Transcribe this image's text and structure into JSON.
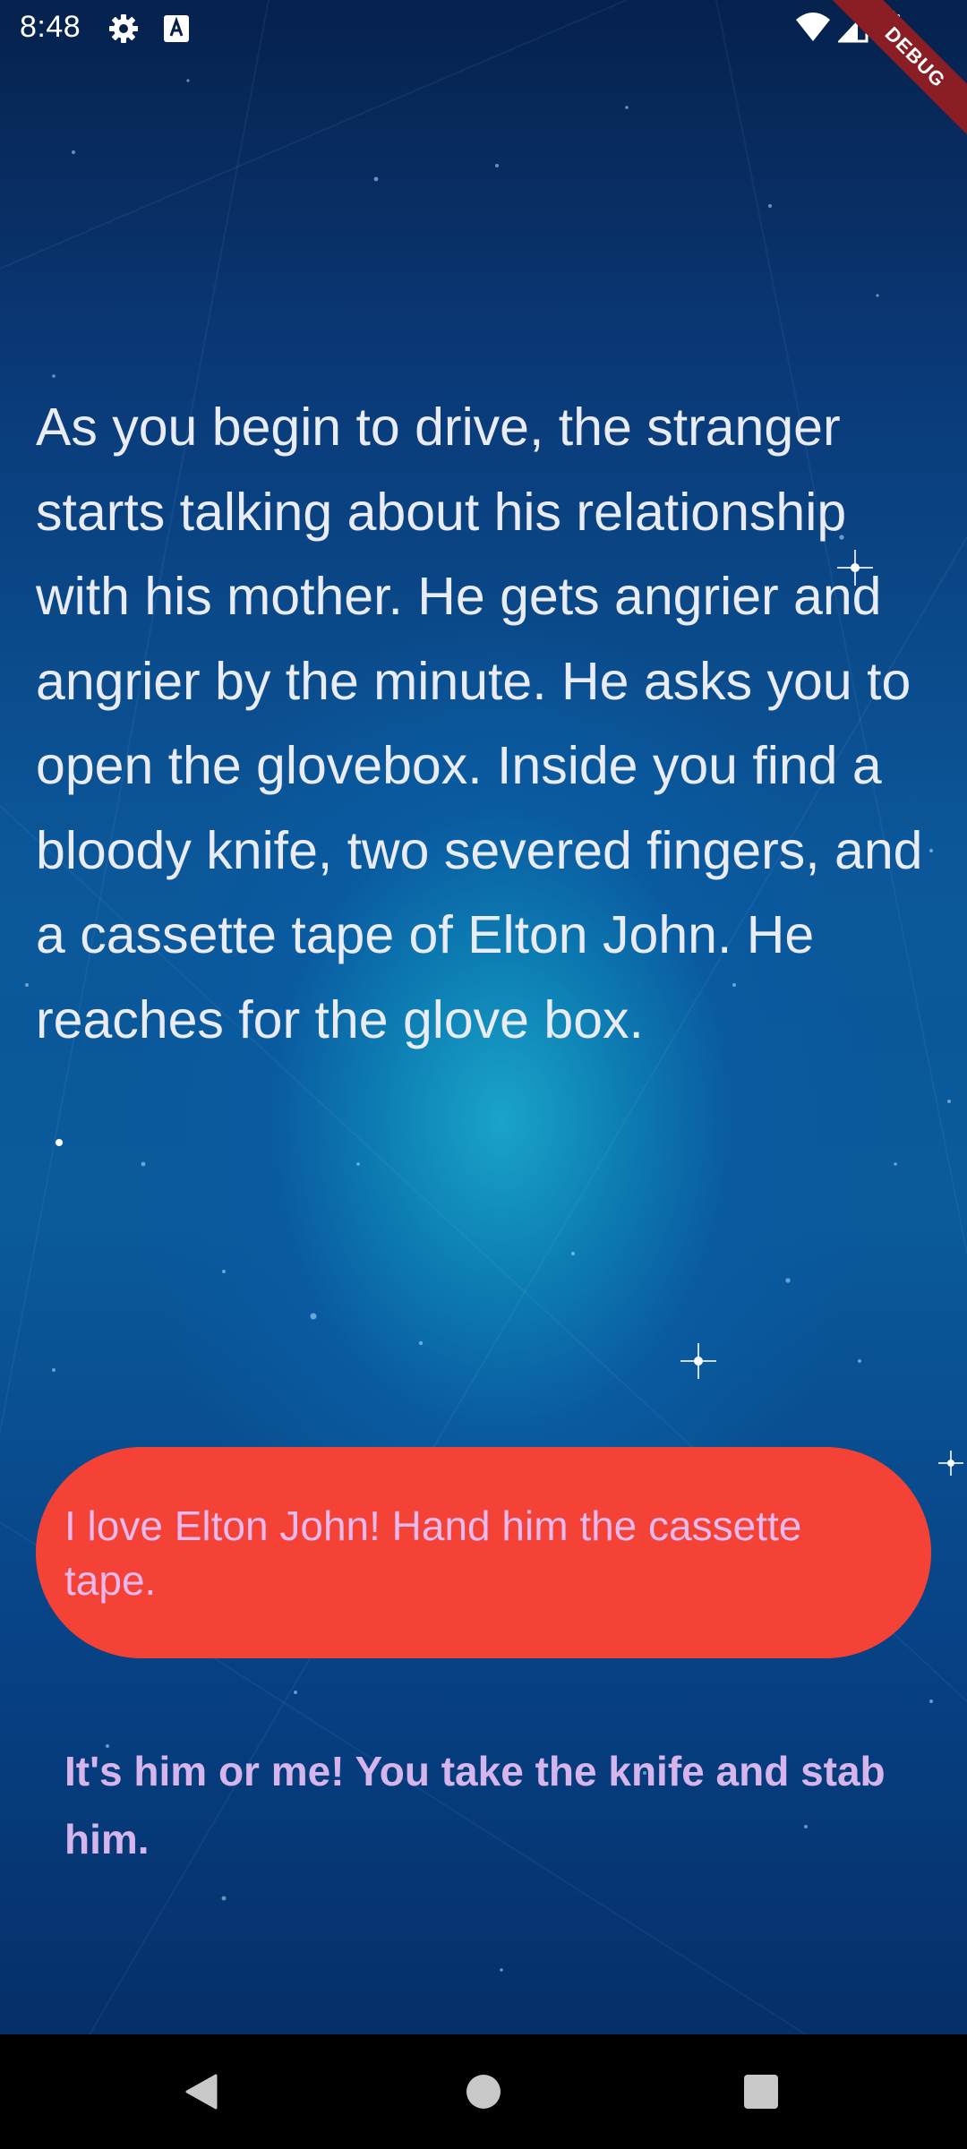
{
  "status_bar": {
    "time": "8:48",
    "icons": [
      "settings-gear-icon",
      "a-keyboard-icon",
      "wifi-icon",
      "cell-signal-icon",
      "battery-icon"
    ],
    "debug_label": "DEBUG"
  },
  "story": {
    "text": "As you begin to drive, the stranger starts talking about his relationship with his mother. He gets angrier and angrier by the minute. He asks you to open the glovebox. Inside you find a bloody knife, two severed fingers, and a cassette tape of Elton John. He reaches for the glove box."
  },
  "choices": {
    "choice1": "I love Elton John! Hand him the cassette tape.",
    "choice2": "It's him or me! You take the knife and stab him."
  },
  "colors": {
    "choice1_bg": "#f44336",
    "choice1_text": "#e9b8ec",
    "choice2_text": "#d6b5ec",
    "story_text": "#e9ecf5",
    "debug_ribbon": "#8b1d24"
  },
  "nav_bar": {
    "icons": [
      "back-triangle-icon",
      "home-circle-icon",
      "recents-square-icon"
    ]
  }
}
